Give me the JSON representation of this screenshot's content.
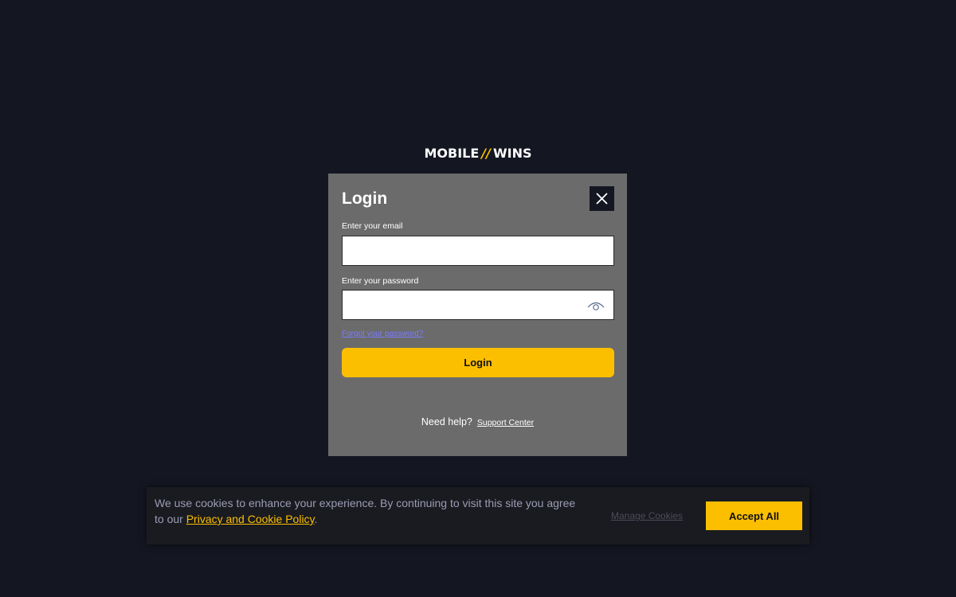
{
  "brand": {
    "logo_left": "MOBILE",
    "logo_sep": "//",
    "logo_right": "WINS"
  },
  "modal": {
    "title": "Login",
    "close_icon": "close-icon",
    "email_label": "Enter your email",
    "email_value": "",
    "password_label": "Enter your password",
    "password_value": "",
    "password_toggle_icon": "eye-icon",
    "forgot_link": "Forgot your password?",
    "login_button": "Login",
    "help_text": "Need help?",
    "support_link": "Support Center"
  },
  "cookie_bar": {
    "text_before": "We use cookies to enhance your experience. By continuing to visit this site you agree to our ",
    "policy_link": "Privacy and Cookie Policy",
    "text_after": ".",
    "manage_link": "Manage Cookies",
    "accept_button": "Accept All"
  },
  "colors": {
    "background": "#141622",
    "accent": "#fbbf00",
    "modal_bg": "#6b6b6b",
    "link": "#7c7cff"
  }
}
